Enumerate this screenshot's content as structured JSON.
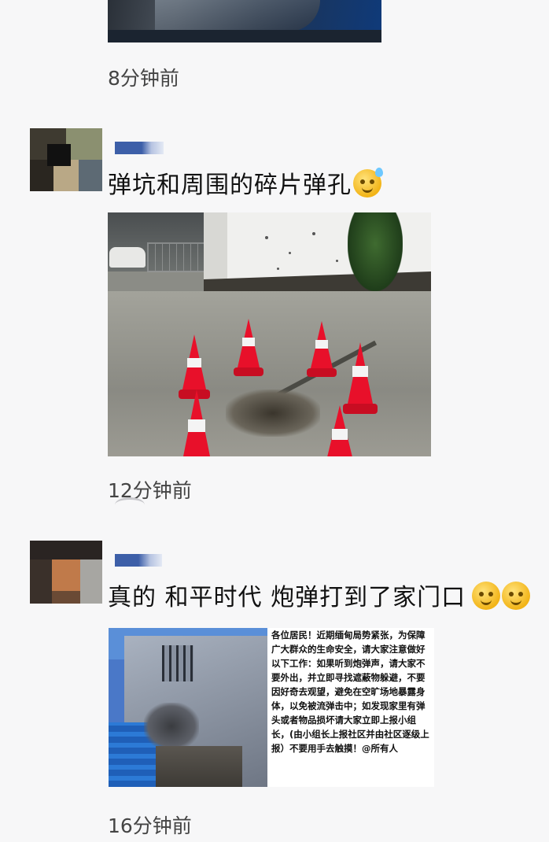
{
  "feed": {
    "post0": {
      "time": "8分钟前"
    },
    "post1": {
      "text": "弹坑和周围的碎片弹孔",
      "emoji": "sweat-emoji",
      "time": "12分钟前"
    },
    "post2": {
      "text": "真的 和平时代 炮弹打到了家门口",
      "emoji": "smile-emoji",
      "time": "16分钟前",
      "notice": "各位居民！近期缅甸局势紧张，为保障广大群众的生命安全，请大家注意做好以下工作：如果听到炮弹声，请大家不要外出，并立即寻找遮蔽物躲避，不要因好奇去观望，避免在空旷场地暴露身体，以免被流弹击中；如发现家里有弹头或者物品损坏请大家立即上报小组长，(由小组长上报社区并由社区逐级上报）不要用手去触摸！@所有人"
    }
  },
  "colors": {
    "background": "#f7f7f8",
    "name_bar": "#3d5fa8",
    "cone": "#e8102a"
  }
}
